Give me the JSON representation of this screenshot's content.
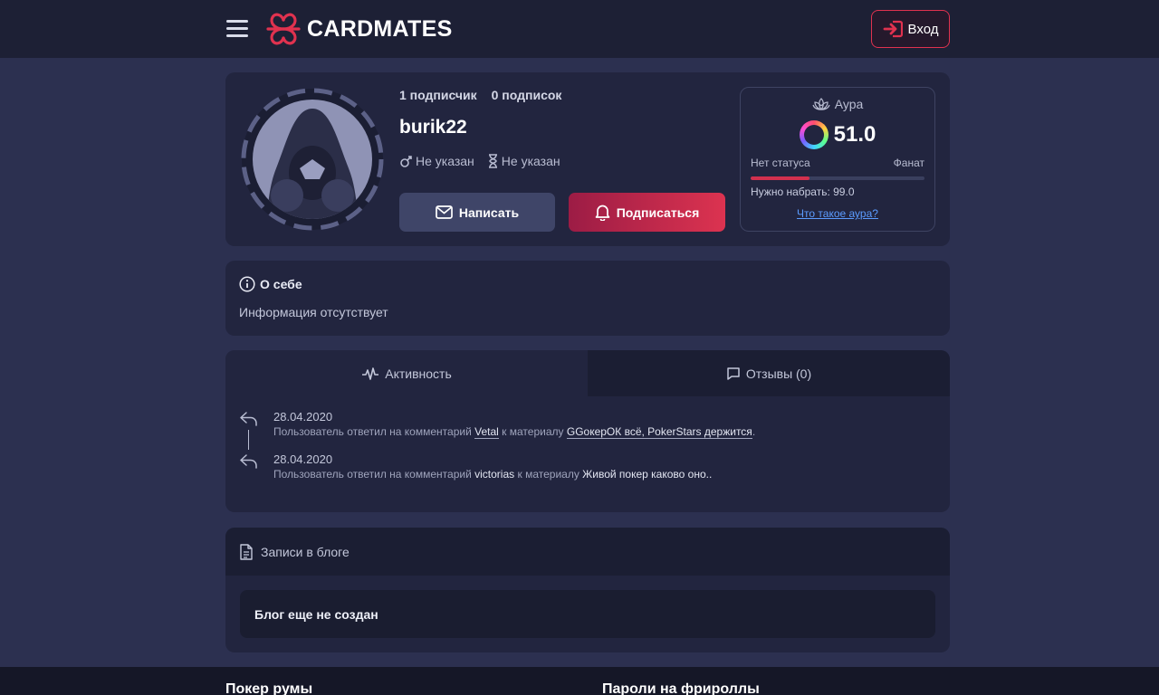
{
  "header": {
    "logo_text": "CARDMATES",
    "login_label": "Вход",
    "accent_color": "#e0324f"
  },
  "profile": {
    "followers": "1 подписчик",
    "following": "0 подписок",
    "username": "burik22",
    "gender": "Не указан",
    "age": "Не указан",
    "write_label": "Написать",
    "subscribe_label": "Подписаться"
  },
  "aura": {
    "title": "Аура",
    "value": "51.0",
    "status_left": "Нет статуса",
    "status_right": "Фанат",
    "progress_fraction": 0.34,
    "need": "Нужно набрать: 99.0",
    "link": "Что такое аура?"
  },
  "about": {
    "title": "О себе",
    "text": "Информация отсутствует"
  },
  "activity": {
    "tabs": [
      {
        "label": "Активность",
        "active": true
      },
      {
        "label": "Отзывы (0)",
        "active": false
      }
    ],
    "items": [
      {
        "date": "28.04.2020",
        "prefix": "Пользователь ответил на комментарий",
        "user": "Vetal",
        "middle": "к материалу",
        "material": "GGокерОК всё, PokerStars держится",
        "suffix": "."
      },
      {
        "date": "28.04.2020",
        "prefix": "Пользователь ответил на комментарий",
        "user": "victorias",
        "middle": "к материалу",
        "material": "Живой покер каково оно..",
        "suffix": ""
      }
    ]
  },
  "blog": {
    "title": "Записи в блоге",
    "empty": "Блог еще не создан"
  },
  "footer": {
    "col1": "Покер румы",
    "col2": "Пароли на фрироллы"
  }
}
